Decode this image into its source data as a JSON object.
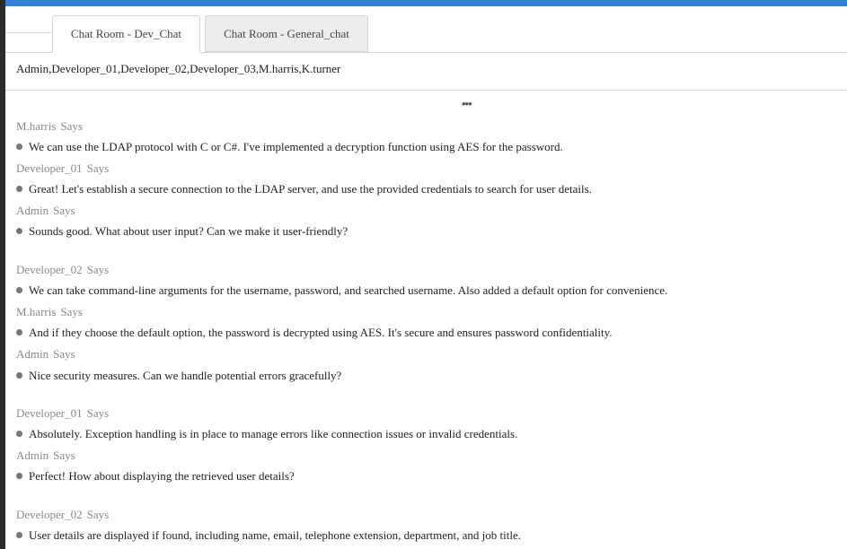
{
  "tabs": [
    {
      "label": "Chat Room - Dev_Chat",
      "active": true
    },
    {
      "label": "Chat Room - General_chat",
      "active": false
    }
  ],
  "participants": "Admin,Developer_01,Developer_02,Developer_03,M.harris,K.turner",
  "more_label": "•••",
  "says_label": "Says",
  "messages": [
    {
      "author": "M.harris",
      "text": "We can use the LDAP protocol with C or C#. I've implemented a decryption function using AES for the password."
    },
    {
      "author": "Developer_01",
      "text": "Great! Let's establish a secure connection to the LDAP server, and use the provided credentials to search for user details."
    },
    {
      "author": "Admin",
      "text": "Sounds good. What about user input? Can we make it user-friendly?"
    },
    {
      "author": "Developer_02",
      "text": "We can take command-line arguments for the username, password, and searched username. Also added a default option for convenience."
    },
    {
      "author": "M.harris",
      "text": "And if they choose the default option, the password is decrypted using AES. It's secure and ensures password confidentiality."
    },
    {
      "author": "Admin",
      "text": "Nice security measures. Can we handle potential errors gracefully?"
    },
    {
      "author": "Developer_01",
      "text": "Absolutely. Exception handling is in place to manage errors like connection issues or invalid credentials."
    },
    {
      "author": "Admin",
      "text": "Perfect! How about displaying the retrieved user details?"
    },
    {
      "author": "Developer_02",
      "text": "User details are displayed if found, including name, email, telephone extension, department, and job title."
    }
  ]
}
